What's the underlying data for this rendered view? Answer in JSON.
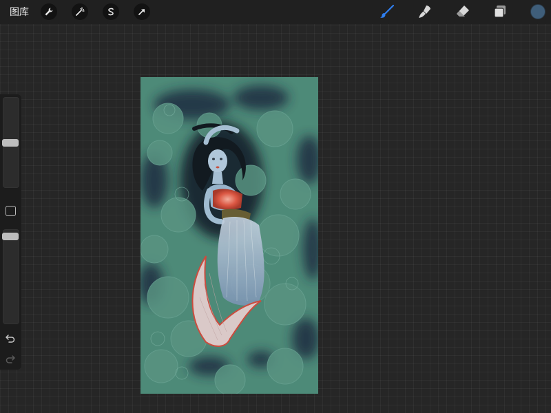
{
  "topbar": {
    "gallery_label": "图库",
    "left_tools": [
      "wrench-icon",
      "magic-wand-icon",
      "selection-icon",
      "transform-arrow-icon"
    ],
    "right_tools": [
      "brush-icon",
      "smudge-icon",
      "eraser-icon",
      "layers-icon"
    ],
    "active_tool": "brush-icon",
    "accent_color": "#2f7ff0",
    "current_color": "#3f5e7a"
  },
  "sidebar": {
    "brush_size": 0.5,
    "opacity": 0.97
  },
  "canvas": {
    "background_color": "#4e8a79"
  }
}
